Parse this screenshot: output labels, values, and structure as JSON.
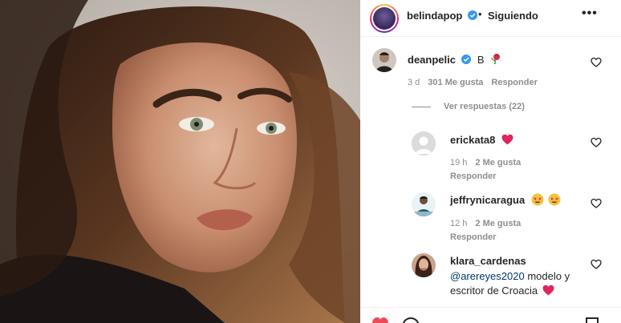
{
  "post": {
    "author": "belindapop",
    "separator": "•",
    "follow_status": "Siguiendo",
    "more": "•••"
  },
  "comments": [
    {
      "user": "deanpelic",
      "text": "B",
      "time": "3 d",
      "likes": "301 Me gusta",
      "reply": "Responder",
      "view_replies": "Ver respuestas (22)"
    },
    {
      "user": "erickata8",
      "time": "19 h",
      "likes": "2 Me gusta",
      "reply": "Responder"
    },
    {
      "user": "jeffrynicaragua",
      "time": "12 h",
      "likes": "2 Me gusta",
      "reply": "Responder"
    },
    {
      "user": "klara_cardenas",
      "mention": "@arereyes2020",
      "text_line1": " modelo y",
      "text_line2": "escritor de Croacia"
    }
  ],
  "colors": {
    "verified": "#3897f0",
    "heart_emoji": "#e0245e",
    "mention": "#00376b",
    "muted": "#8e8e8e"
  }
}
